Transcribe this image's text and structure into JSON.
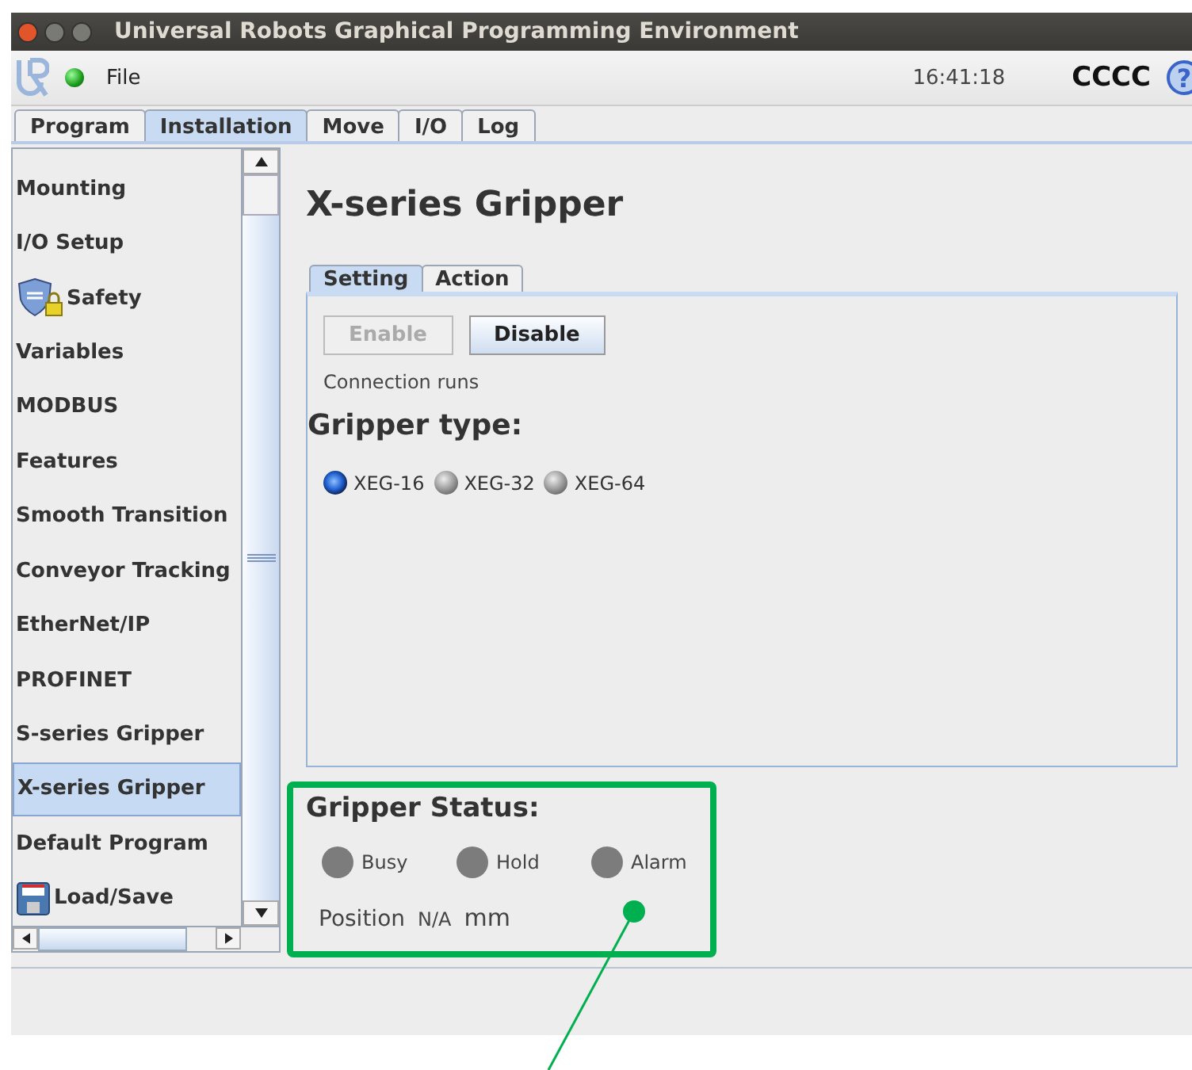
{
  "window": {
    "title": "Universal Robots Graphical Programming Environment"
  },
  "toolbar": {
    "menu": "File",
    "time": "16:41:18",
    "robot_name": "CCCC",
    "help": "?"
  },
  "tabs": [
    {
      "label": "Program",
      "selected": false
    },
    {
      "label": "Installation",
      "selected": true
    },
    {
      "label": "Move",
      "selected": false
    },
    {
      "label": "I/O",
      "selected": false
    },
    {
      "label": "Log",
      "selected": false
    }
  ],
  "sidebar": {
    "items": [
      {
        "label": "Mounting",
        "selected": false
      },
      {
        "label": "I/O Setup",
        "selected": false
      },
      {
        "label": "Safety",
        "selected": false,
        "kind": "shield"
      },
      {
        "label": "Variables",
        "selected": false
      },
      {
        "label": "MODBUS",
        "selected": false
      },
      {
        "label": "Features",
        "selected": false
      },
      {
        "label": "Smooth Transition",
        "selected": false
      },
      {
        "label": "Conveyor Tracking",
        "selected": false
      },
      {
        "label": "EtherNet/IP",
        "selected": false
      },
      {
        "label": "PROFINET",
        "selected": false
      },
      {
        "label": "S-series Gripper",
        "selected": false
      },
      {
        "label": "X-series Gripper",
        "selected": true
      },
      {
        "label": "Default Program",
        "selected": false
      },
      {
        "label": "Load/Save",
        "selected": false,
        "kind": "floppy"
      }
    ]
  },
  "content": {
    "title": "X-series Gripper",
    "tabs": [
      {
        "label": "Setting",
        "selected": true
      },
      {
        "label": "Action",
        "selected": false
      }
    ],
    "buttons": [
      {
        "label": "Enable",
        "disabled": true
      },
      {
        "label": "Disable",
        "disabled": false
      }
    ],
    "connection_status": "Connection runs",
    "gripper_type_heading": "Gripper type:",
    "gripper_types": [
      {
        "label": "XEG-16",
        "selected": true
      },
      {
        "label": "XEG-32",
        "selected": false
      },
      {
        "label": "XEG-64",
        "selected": false
      }
    ],
    "status": {
      "heading": "Gripper Status:",
      "indicators": [
        {
          "label": "Busy",
          "on": false
        },
        {
          "label": "Hold",
          "on": false
        },
        {
          "label": "Alarm",
          "on": false
        }
      ],
      "position_label": "Position",
      "position_value": "N/A",
      "position_unit": "mm"
    }
  }
}
